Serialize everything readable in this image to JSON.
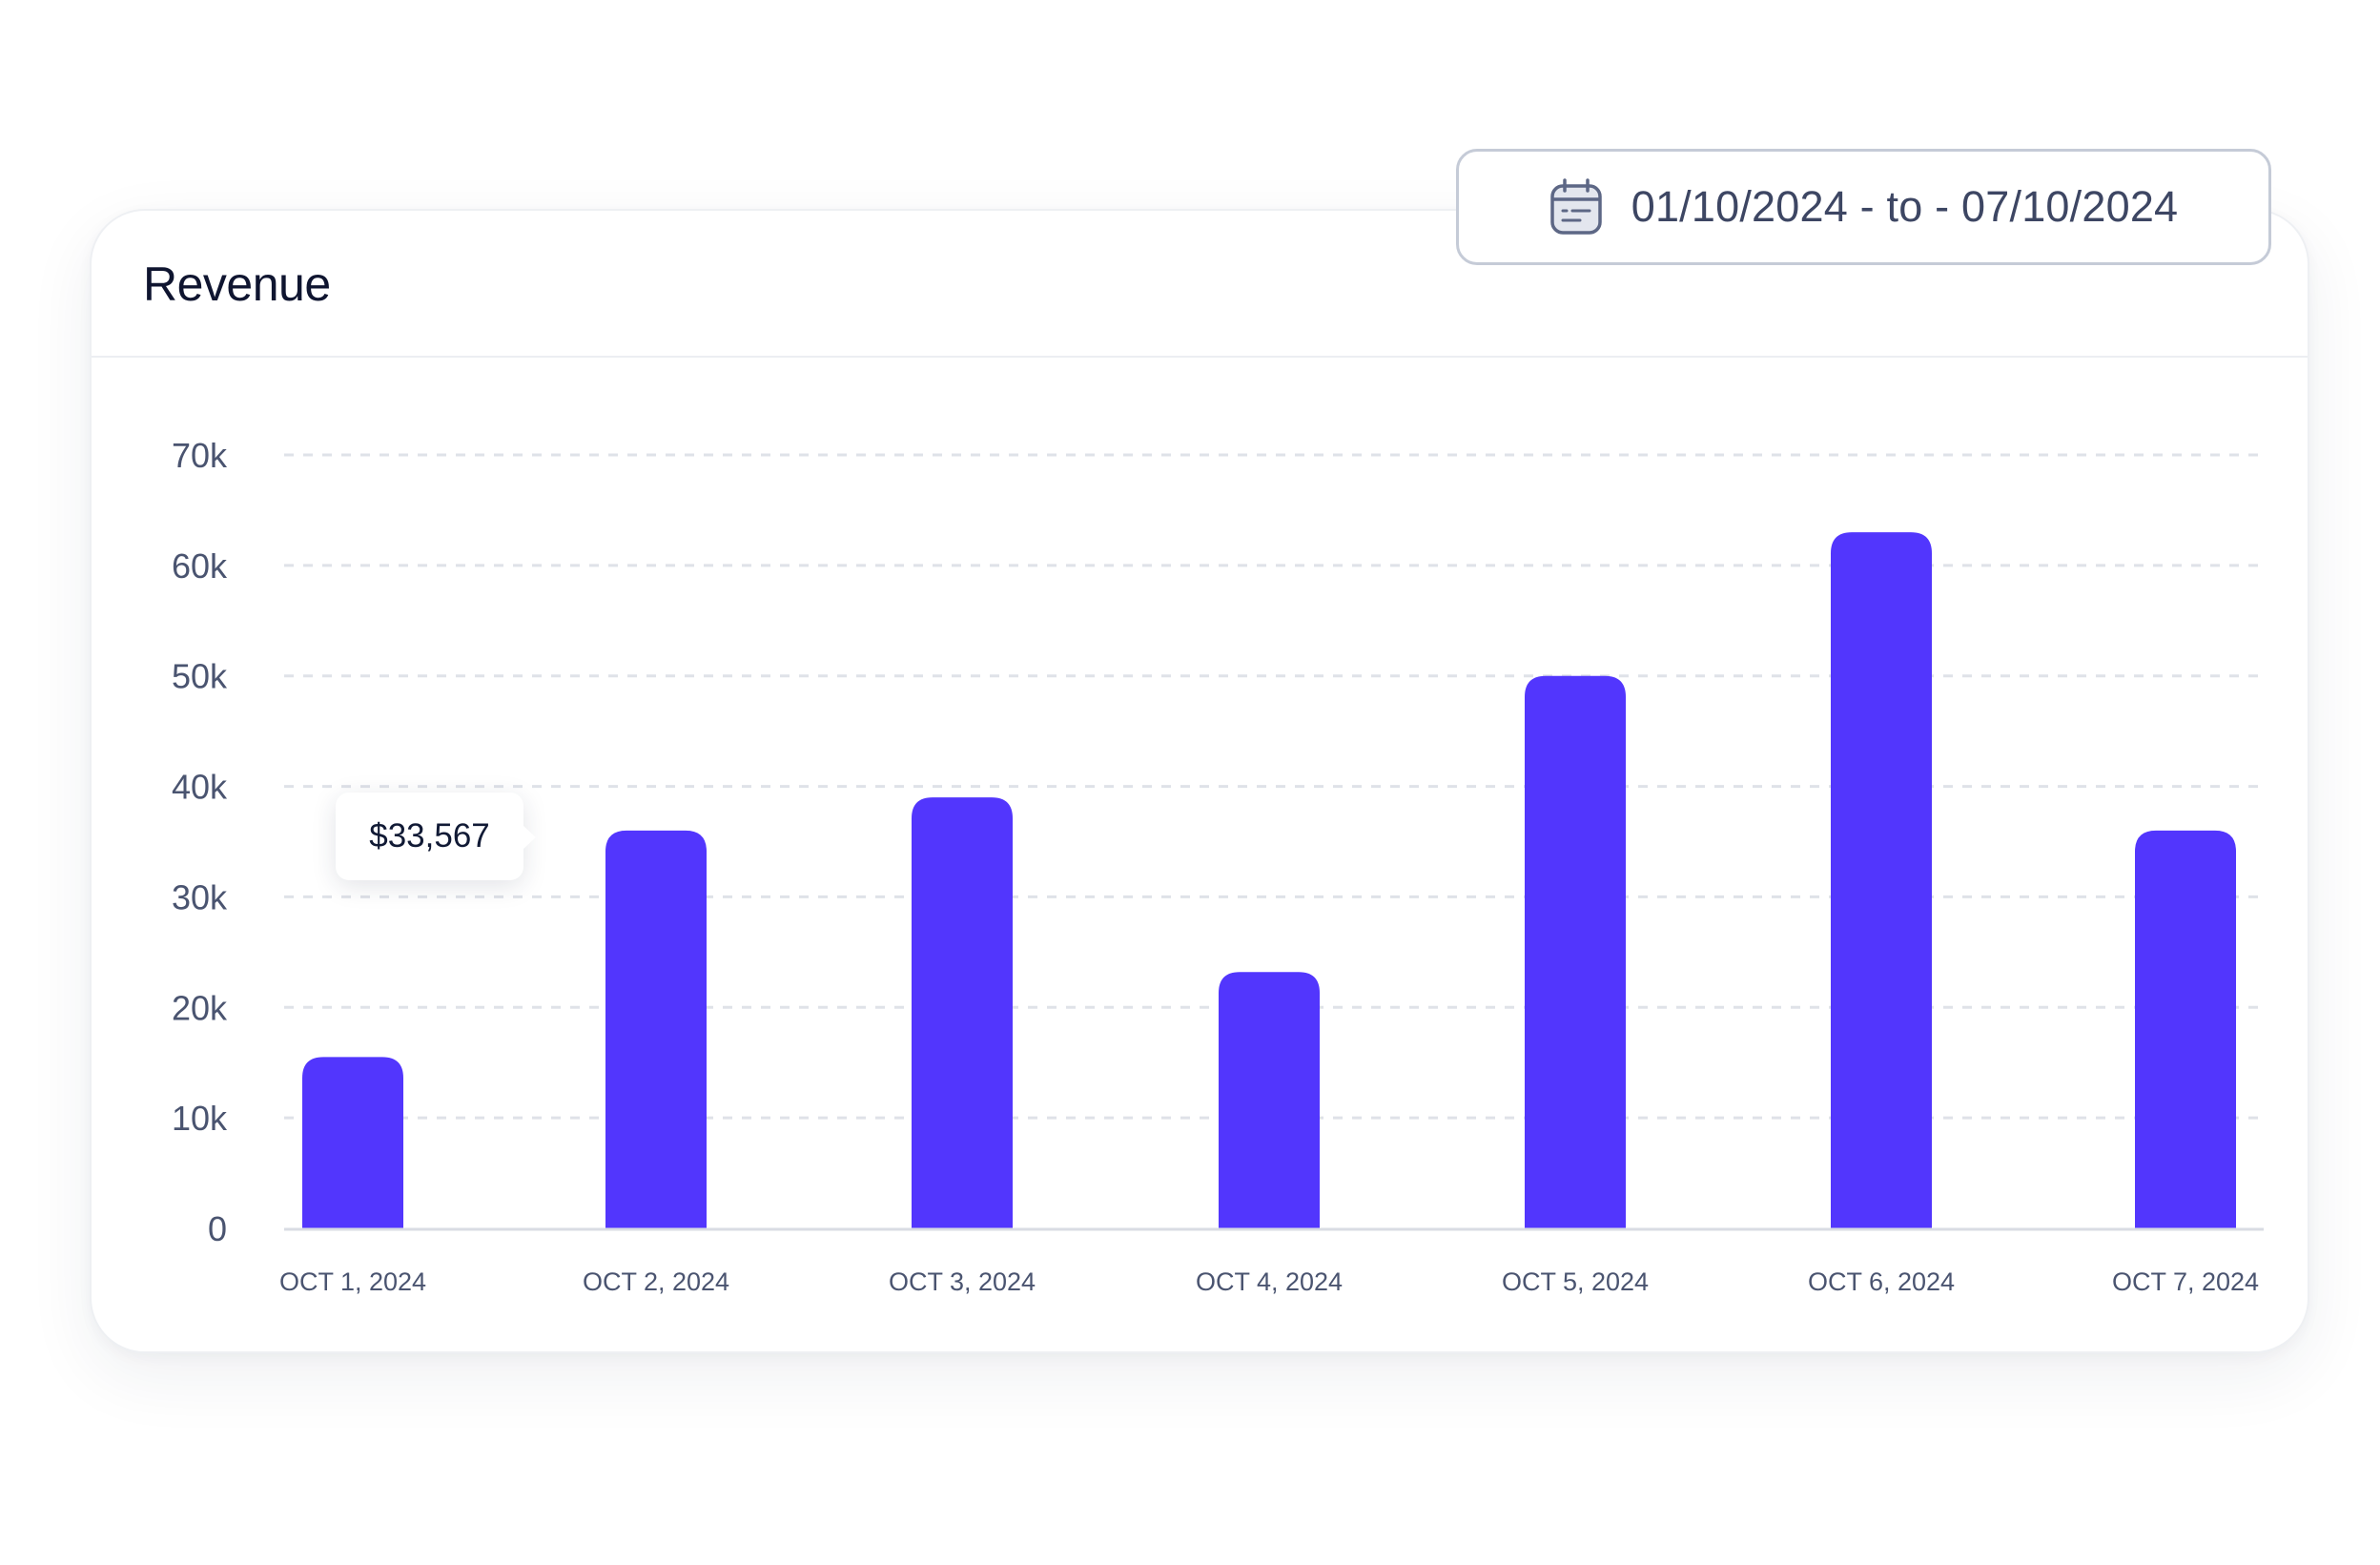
{
  "card": {
    "title": "Revenue"
  },
  "date_range": {
    "icon": "calendar-icon",
    "label": "01/10/2024 - to - 07/10/2024"
  },
  "tooltip": {
    "value": "$33,567"
  },
  "colors": {
    "bar": "#5236fd",
    "grid": "#dfe2e8",
    "axis": "#d9dce3",
    "text": "#4a5470",
    "title": "#0f1530"
  },
  "chart_data": {
    "type": "bar",
    "categories": [
      "OCT 1, 2024",
      "OCT 2, 2024",
      "OCT 3, 2024",
      "OCT 4, 2024",
      "OCT 5, 2024",
      "OCT 6, 2024",
      "OCT 7, 2024"
    ],
    "values": [
      15500,
      36000,
      39000,
      23200,
      50000,
      63000,
      36000
    ],
    "y_ticks": [
      "0",
      "10k",
      "20k",
      "30k",
      "40k",
      "50k",
      "60k",
      "70k"
    ],
    "ylim": [
      0,
      70000
    ],
    "grid": true,
    "legend": "none",
    "title": "Revenue",
    "xlabel": "",
    "ylabel": ""
  }
}
